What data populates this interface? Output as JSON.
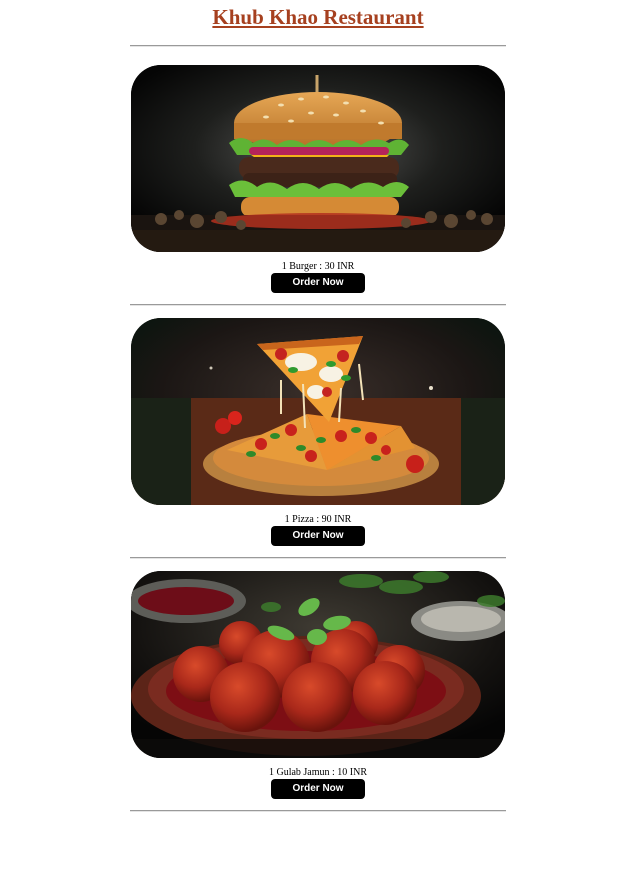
{
  "header": {
    "title": "Khub Khao Restaurant",
    "title_color": "#a6401f"
  },
  "menu": [
    {
      "caption": "1 Burger : 30 INR",
      "button": "Order Now"
    },
    {
      "caption": "1 Pizza : 90 INR",
      "button": "Order Now"
    },
    {
      "caption": "1 Gulab Jamun : 10 INR",
      "button": "Order Now"
    }
  ]
}
